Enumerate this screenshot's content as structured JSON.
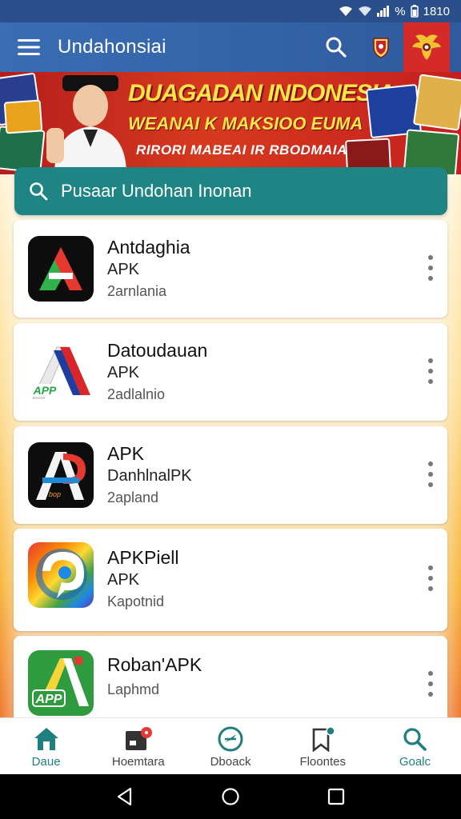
{
  "status_bar": {
    "time": "1810"
  },
  "app_bar": {
    "title": "Undahonsiai"
  },
  "banner": {
    "line1": "DUAGADAN INDONESIA",
    "line2": "WEANAI K MAKSIOO EUMA",
    "line3": "RIRORI MABEAI IR RBODMAIA!"
  },
  "search": {
    "placeholder": "Pusaar Undohan Inonan"
  },
  "apps": [
    {
      "name": "Antdaghia",
      "type": "APK",
      "sub": "2arnlania"
    },
    {
      "name": "Datoudauan",
      "type": "APK",
      "sub": "2adlalnio"
    },
    {
      "name": "APK",
      "type": "DanhlnalPK",
      "sub": "2apland"
    },
    {
      "name": "APKPiell",
      "type": "APK",
      "sub": "Kapotnid"
    },
    {
      "name": "Roban'APK",
      "type": "",
      "sub": "Laphmd"
    }
  ],
  "app_icon_texts": {
    "app2": "APP",
    "app3": "bop",
    "app5": "APP"
  },
  "bottom_nav": [
    {
      "label": "Daue",
      "icon": "home-icon",
      "active": true
    },
    {
      "label": "Hoemtara",
      "icon": "inbox-icon",
      "badge": true
    },
    {
      "label": "Dboack",
      "icon": "compass-icon"
    },
    {
      "label": "Floontes",
      "icon": "bookmark-icon"
    },
    {
      "label": "Goalc",
      "icon": "search-icon"
    }
  ],
  "colors": {
    "accent": "#1f8484",
    "app_bar": "#3a6db3",
    "banner": "#c41f1f"
  }
}
